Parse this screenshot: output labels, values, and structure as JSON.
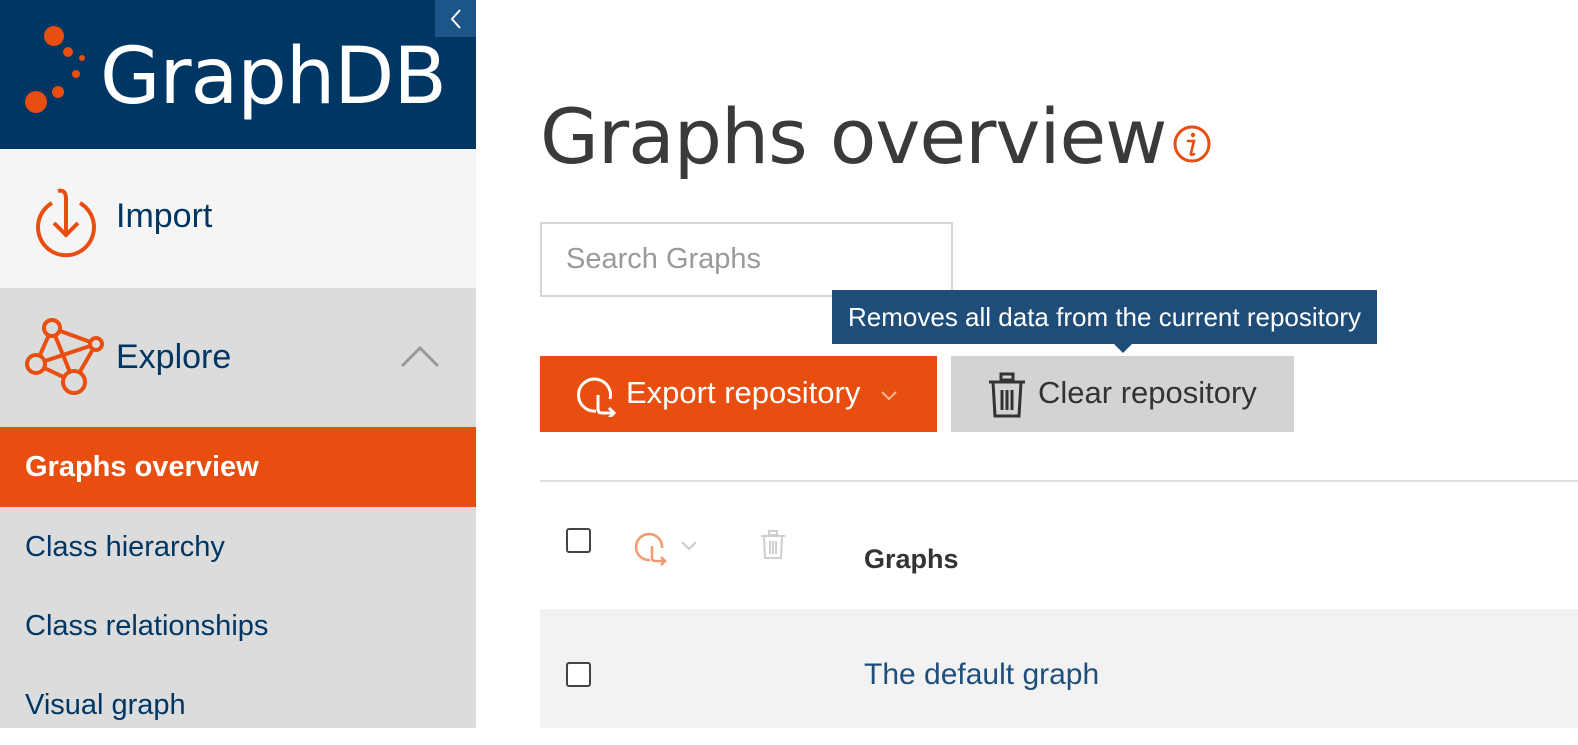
{
  "app": {
    "brand_name": "GraphDB"
  },
  "colors": {
    "brand_blue": "#003663",
    "accent_orange": "#e84e0f",
    "tooltip_blue": "#1f4d7a"
  },
  "sidebar": {
    "collapse_icon": "chevron-left-icon",
    "import": {
      "label": "Import",
      "icon": "import-icon"
    },
    "explore": {
      "label": "Explore",
      "icon": "explore-graph-icon",
      "expanded": true
    },
    "explore_items": [
      {
        "label": "Graphs overview",
        "active": true
      },
      {
        "label": "Class hierarchy",
        "active": false
      },
      {
        "label": "Class relationships",
        "active": false
      },
      {
        "label": "Visual graph",
        "active": false
      }
    ]
  },
  "main": {
    "title": "Graphs overview",
    "info_icon": "info-icon",
    "search": {
      "placeholder": "Search Graphs",
      "value": ""
    },
    "buttons": {
      "export_label": "Export repository",
      "clear_label": "Clear repository"
    },
    "tooltip": "Removes all data from the current repository",
    "table": {
      "column_header": "Graphs",
      "rows": [
        {
          "label": "The default graph",
          "checked": false
        }
      ]
    }
  }
}
